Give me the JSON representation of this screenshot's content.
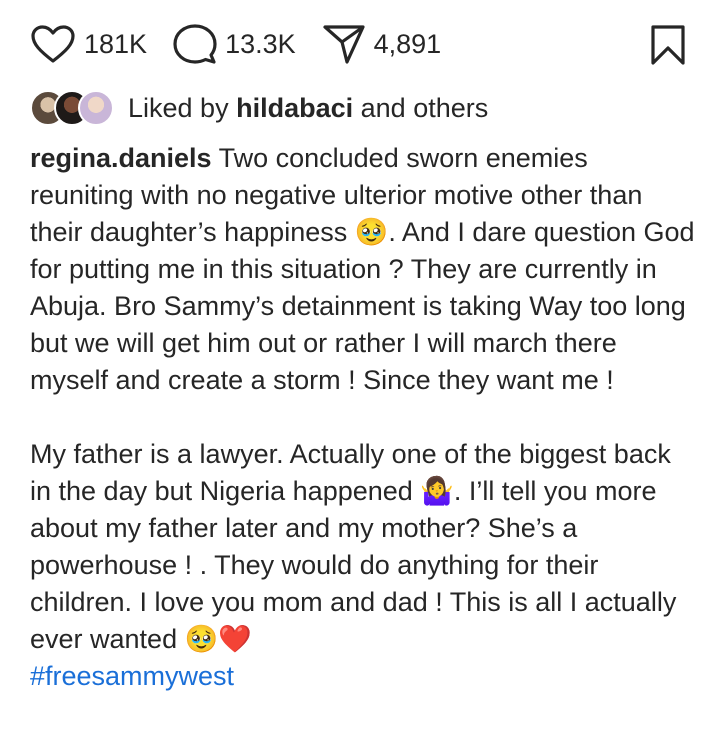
{
  "actions": {
    "likes_count": "181K",
    "comments_count": "13.3K",
    "shares_count": "4,891"
  },
  "likes": {
    "prefix": "Liked by",
    "user": "hildabaci",
    "suffix": "and others"
  },
  "post": {
    "author": "regina.daniels",
    "paragraph1": "Two concluded sworn enemies reuniting with no negative ulterior motive other than their daughter’s happiness 🥹. And I dare question God for putting me in this situation ? They are currently in Abuja. Bro Sammy’s detainment is taking Way too long but we will get him out or rather I will march  there myself and create a storm ! Since they want me !",
    "paragraph2": "My father is a lawyer. Actually one of the biggest back in the day but Nigeria happened 🤷‍♀️. I’ll tell you more about my father later and my mother? She’s a powerhouse ! . They would do anything for their children. I love you mom and dad ! This is all I actually ever wanted 🥹❤️",
    "hashtag": "#freesammywest"
  },
  "colors": {
    "text": "#262626",
    "hashtag": "#1a6fd8",
    "heart_emoji": "#e0245e"
  },
  "icons": [
    "heart-icon",
    "comment-icon",
    "send-icon",
    "bookmark-icon"
  ]
}
